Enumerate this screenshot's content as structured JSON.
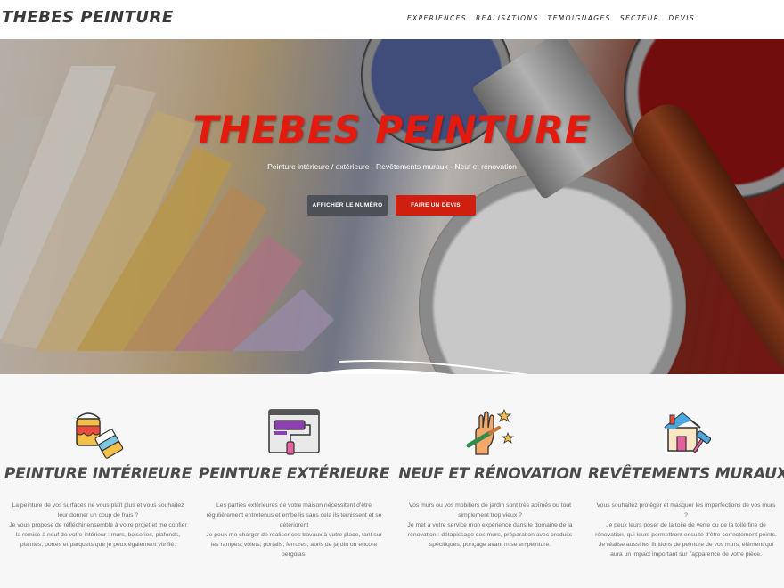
{
  "brand": "THEBES PEINTURE",
  "nav": [
    "EXPERIENCES",
    "REALISATIONS",
    "TEMOIGNAGES",
    "SECTEUR",
    "DEVIS"
  ],
  "hero": {
    "title": "THEBES PEINTURE",
    "subtitle": "Peinture intérieure / extérieure - Revêtements muraux - Neuf et rénovation",
    "btn_phone": "AFFICHER LE NUMÉRO",
    "btn_quote": "FAIRE UN DEVIS"
  },
  "services": [
    {
      "icon": "paint-bucket-swatches-icon",
      "title": "PEINTURE INTÉRIEURE",
      "text": "La peinture de vos surfaces ne vous plaît plus et vous souhaitez leur donner un coup de frais ?\nJe vous propose de réfléchir ensemble à votre projet et me confier la remise à neuf de votre intérieur : murs, boiseries, plafonds, plaintes, portes et parquets que je peux également vitrifié."
    },
    {
      "icon": "paint-roller-wall-icon",
      "title": "PEINTURE EXTÉRIEURE",
      "text": "Les parties extérieures de votre maison nécessitent d'être régulièrement entretenus et embellis sans cela ils ternissent et se déteriorent\nJe peux me charger de réaliser ces travaux à votre place, tant sur les rampes, volets, portails, ferrures, abris de jardin ou encore pergolas."
    },
    {
      "icon": "hand-brush-stars-icon",
      "title": "NEUF ET RÉNOVATION",
      "text": "Vos murs ou vos mobiliers de jardin sont très abîmés ou tout simplement trop vieux ?\nJe met à votre service mon expérience dans le domaine de la rénovation : détapissage des murs, préparation avec produits spécifiques, ponçage avant mise en peinture."
    },
    {
      "icon": "house-paint-roller-icon",
      "title": "REVÊTEMENTS MURAUX",
      "text": "Vous souhaitez protéger et masquer les imperfections de vos murs ?\nJe peux leurs poser de la toile de verre ou de la toile fine de rénovation, qui leurs permettront ensuite d'être correctement peints.\nJe réalise aussi les finitions de peinture de vos murs, élément qui aura un impact important sur l'apparence de votre pièce."
    }
  ],
  "colors": {
    "accent_red": "#cf1f10",
    "button_dark": "#4c5157",
    "heading_grey": "#4a4a4a"
  }
}
